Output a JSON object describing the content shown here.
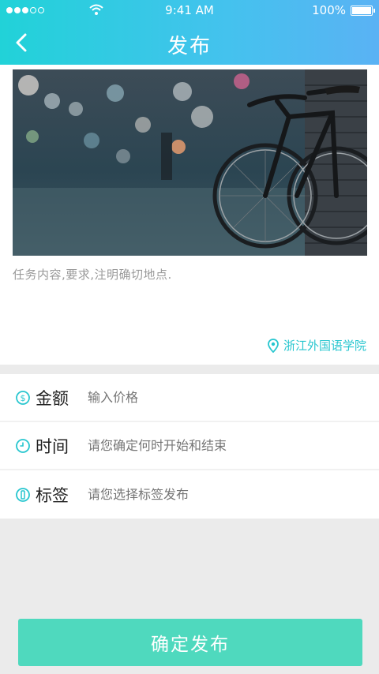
{
  "status_bar": {
    "time": "9:41 AM",
    "battery": "100%",
    "signal_bars_filled": 3,
    "signal_bars_total": 5
  },
  "nav": {
    "title": "发布",
    "back_icon": "chevron-left-icon"
  },
  "post": {
    "content_placeholder": "任务内容,要求,注明确切地点.",
    "location": "浙江外国语学院",
    "location_icon": "map-pin-icon"
  },
  "form": {
    "fields": [
      {
        "icon": "dollar-icon",
        "label": "金额",
        "placeholder": "输入价格"
      },
      {
        "icon": "clock-icon",
        "label": "时间",
        "placeholder": "请您确定何时开始和结束"
      },
      {
        "icon": "tag-icon",
        "label": "标签",
        "placeholder": "请您选择标签发布"
      }
    ]
  },
  "submit_label": "确定发布",
  "colors": {
    "header_start": "#21d2d8",
    "header_end": "#5ab2f4",
    "accent": "#27c6cf",
    "submit": "#4fd9be"
  }
}
